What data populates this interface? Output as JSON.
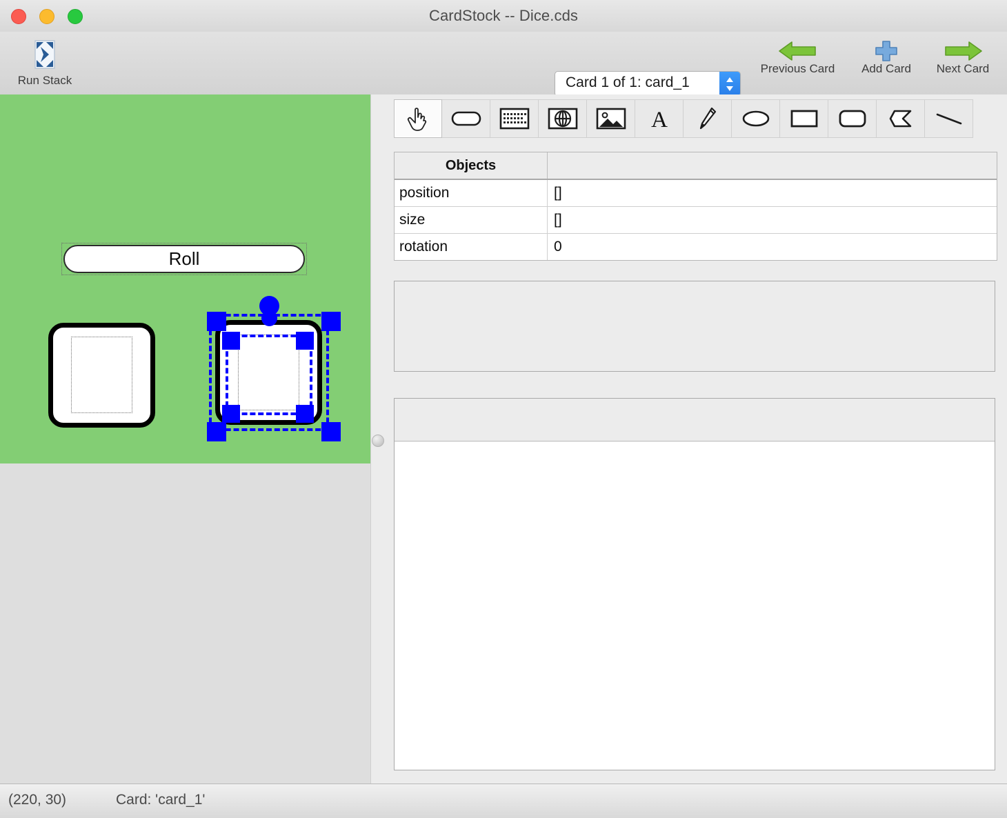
{
  "window": {
    "title": "CardStock -- Dice.cds",
    "controls": {
      "close": "close-button",
      "minimize": "minimize-button",
      "zoom": "zoom-button"
    }
  },
  "toolbar": {
    "run_stack_label": "Run Stack",
    "card_selector_value": "Card 1 of 1: card_1",
    "previous_card_label": "Previous Card",
    "add_card_label": "Add Card",
    "next_card_label": "Next Card"
  },
  "tools": [
    {
      "name": "hand-tool",
      "icon": "pointing-hand-icon",
      "selected": true
    },
    {
      "name": "button-tool",
      "icon": "rounded-button-icon",
      "selected": false
    },
    {
      "name": "textfield-tool",
      "icon": "text-field-icon",
      "selected": false
    },
    {
      "name": "webview-tool",
      "icon": "globe-icon",
      "selected": false
    },
    {
      "name": "image-tool",
      "icon": "image-icon",
      "selected": false
    },
    {
      "name": "label-tool",
      "icon": "letter-a-icon",
      "selected": false
    },
    {
      "name": "pen-tool",
      "icon": "pencil-icon",
      "selected": false
    },
    {
      "name": "oval-tool",
      "icon": "oval-icon",
      "selected": false
    },
    {
      "name": "rect-tool",
      "icon": "rectangle-icon",
      "selected": false
    },
    {
      "name": "roundrect-tool",
      "icon": "rounded-rect-icon",
      "selected": false
    },
    {
      "name": "polygon-tool",
      "icon": "polygon-icon",
      "selected": false
    },
    {
      "name": "line-tool",
      "icon": "line-icon",
      "selected": false
    }
  ],
  "property_grid": {
    "header": {
      "name_column": "Objects",
      "value_column": ""
    },
    "rows": [
      {
        "property": "position",
        "value": "[]"
      },
      {
        "property": "size",
        "value": "[]"
      },
      {
        "property": "rotation",
        "value": "0"
      }
    ]
  },
  "card": {
    "background_color": "#83ce74",
    "objects": {
      "roll_button": {
        "label": "Roll",
        "selected": false
      },
      "die_1": {
        "label": "",
        "selected": false
      },
      "die_2": {
        "label": "",
        "selected": true
      }
    }
  },
  "handler_panel": {
    "text": ""
  },
  "code_editor": {
    "text": ""
  },
  "status_bar": {
    "coordinates": "(220, 30)",
    "card_info": "Card: 'card_1'"
  },
  "colors": {
    "selection_blue": "#0000FF",
    "card_green": "#83CE74",
    "chrome_gray": "#ECECEC",
    "accent_blue": "#3D9BFB",
    "arrow_green": "#7CC43A",
    "plus_blue": "#6FA8DC"
  }
}
